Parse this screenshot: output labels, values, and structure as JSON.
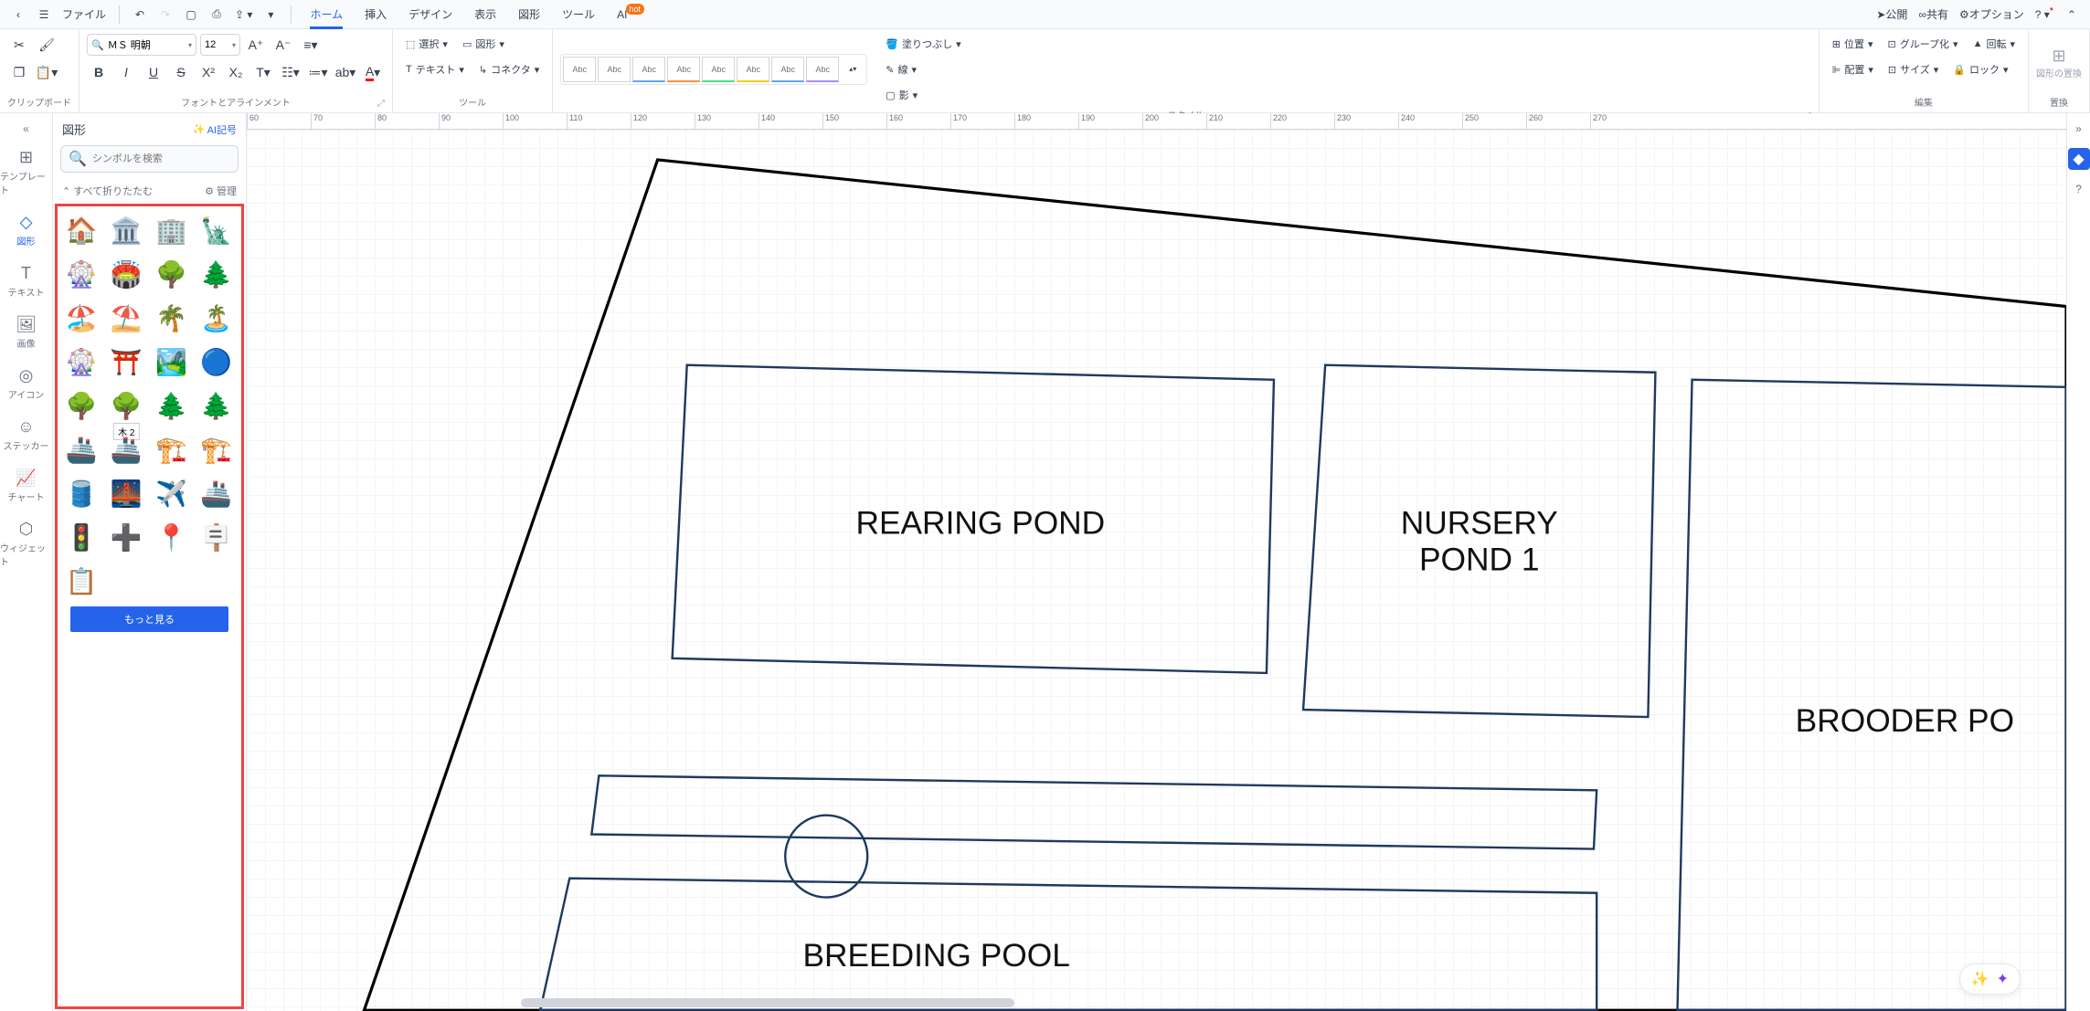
{
  "menubar": {
    "file": "ファイル",
    "tabs": [
      "ホーム",
      "挿入",
      "デザイン",
      "表示",
      "図形",
      "ツール",
      "AI"
    ],
    "active_tab": 0,
    "hot_badge": "hot",
    "publish": "公開",
    "share": "共有",
    "options": "オプション"
  },
  "ribbon": {
    "clipboard_label": "クリップボード",
    "font_name": "ＭＳ 明朝",
    "font_size": "12",
    "font_align_label": "フォントとアラインメント",
    "select_label": "選択",
    "shape_label": "図形",
    "text_label": "テキスト",
    "connector_label": "コネクタ",
    "tool_label": "ツール",
    "style_item": "Abc",
    "fill": "塗りつぶし",
    "line": "線",
    "shadow": "影",
    "style_label": "スタイル",
    "position": "位置",
    "align": "配置",
    "group": "グループ化",
    "size": "サイズ",
    "rotate": "回転",
    "lock": "ロック",
    "edit_label": "編集",
    "replace_shape": "図形の置換",
    "replace_label": "置換"
  },
  "leftbar": {
    "items": [
      {
        "label": "テンプレート"
      },
      {
        "label": "図形"
      },
      {
        "label": "テキスト"
      },
      {
        "label": "画像"
      },
      {
        "label": "アイコン"
      },
      {
        "label": "ステッカー"
      },
      {
        "label": "チャート"
      },
      {
        "label": "ウィジェット"
      }
    ],
    "active": 1
  },
  "shapes_panel": {
    "title": "図形",
    "ai": "AI記号",
    "search_placeholder": "シンボルを検索",
    "fold_all": "すべて折りたたむ",
    "manage": "管理",
    "more": "もっと見る",
    "tooltip": "木 2",
    "shapes": [
      "🏠",
      "🏛️",
      "🏢",
      "🗽",
      "🎡",
      "🏟️",
      "🌳",
      "🌲",
      "🏖️",
      "⛱️",
      "🌴",
      "🏝️",
      "🎡",
      "⛩️",
      "🏞️",
      "🔵",
      "🌳",
      "🌳",
      "🌲",
      "🌲",
      "🚢",
      "🚢",
      "🏗️",
      "🏗️",
      "🛢️",
      "🌉",
      "✈️",
      "🚢",
      "🚦",
      "➕",
      "📍",
      "🪧",
      "📋",
      "",
      "",
      ""
    ]
  },
  "ruler": {
    "start": 60,
    "step": 10,
    "count": 22
  },
  "canvas": {
    "rearing": "REARING POND",
    "nursery": "NURSERY\nPOND 1",
    "brooder": "BROODER PO",
    "breeding": "BREEDING POOL"
  }
}
